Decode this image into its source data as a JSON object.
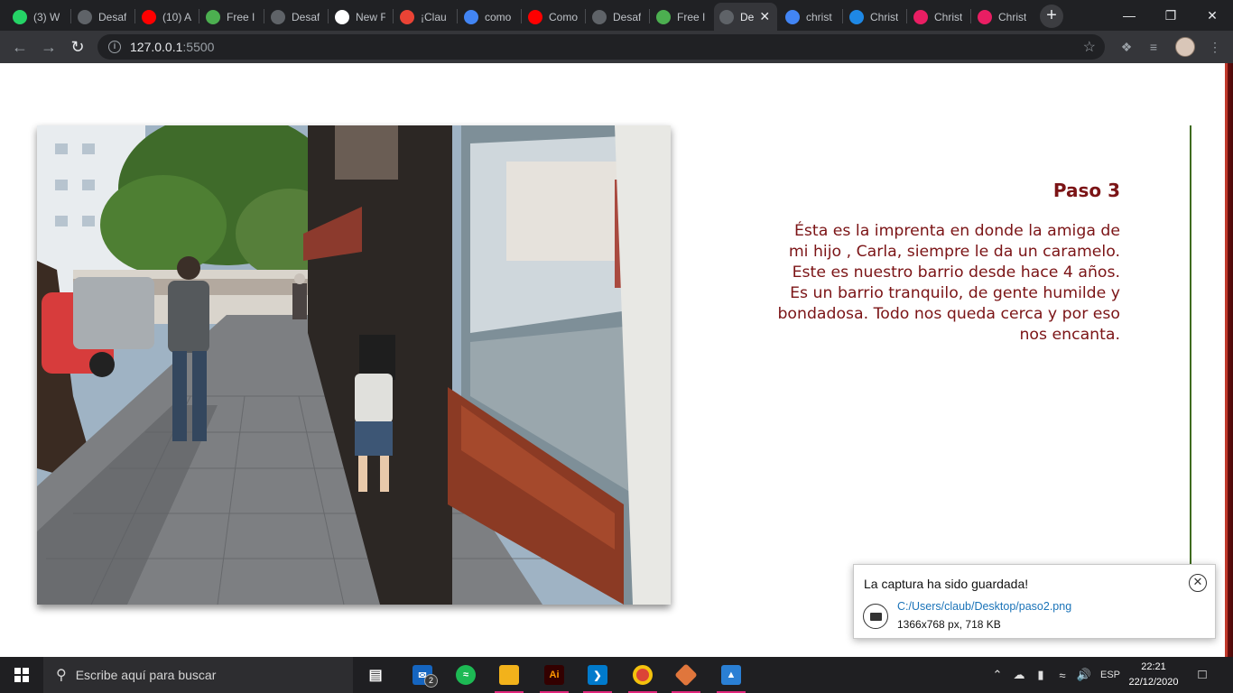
{
  "browser": {
    "tabs": [
      {
        "label": "(3) W",
        "icon": "whatsapp-icon",
        "color": "#25d366"
      },
      {
        "label": "Desaf",
        "icon": "globe-icon",
        "color": "#5f6368"
      },
      {
        "label": "(10) A",
        "icon": "youtube-icon",
        "color": "#ff0000"
      },
      {
        "label": "Free I",
        "icon": "free-images-icon",
        "color": "#4caf50"
      },
      {
        "label": "Desaf",
        "icon": "globe-icon",
        "color": "#5f6368"
      },
      {
        "label": "New F",
        "icon": "github-icon",
        "color": "#ffffff"
      },
      {
        "label": "¡Clau",
        "icon": "gmail-icon",
        "color": "#ea4335"
      },
      {
        "label": "como",
        "icon": "google-icon",
        "color": "#4285f4"
      },
      {
        "label": "Como",
        "icon": "youtube-icon",
        "color": "#ff0000"
      },
      {
        "label": "Desaf",
        "icon": "globe-icon",
        "color": "#5f6368"
      },
      {
        "label": "Free I",
        "icon": "free-images-icon",
        "color": "#4caf50"
      },
      {
        "label": "De",
        "icon": "globe-icon",
        "color": "#5f6368",
        "active": true
      },
      {
        "label": "christ",
        "icon": "google-icon",
        "color": "#4285f4"
      },
      {
        "label": "Christ",
        "icon": "gif-icon",
        "color": "#1e88e5"
      },
      {
        "label": "Christ",
        "icon": "document-icon",
        "color": "#e91e63"
      },
      {
        "label": "Christ",
        "icon": "document-icon",
        "color": "#e91e63"
      }
    ],
    "url_host": "127.0.0.1",
    "url_port": ":5500"
  },
  "page": {
    "step_title": "Paso 3",
    "step_text": "Ésta es la imprenta en donde la amiga de mi hijo , Carla, siempre le da un caramelo. Este es nuestro barrio desde hace 4 años. Es un barrio tranquilo, de gente humilde y bondadosa. Todo nos queda cerca y por eso nos encanta.",
    "accent_color": "#7b1416"
  },
  "toast": {
    "title": "La captura ha sido guardada!",
    "path": "C:/Users/claub/Desktop/paso2.png",
    "meta": "1366x768 px, 718 KB"
  },
  "taskbar": {
    "search_placeholder": "Escribe aquí para buscar",
    "mail_badge": "2",
    "language": "ESP",
    "time": "22:21",
    "date": "22/12/2020"
  }
}
